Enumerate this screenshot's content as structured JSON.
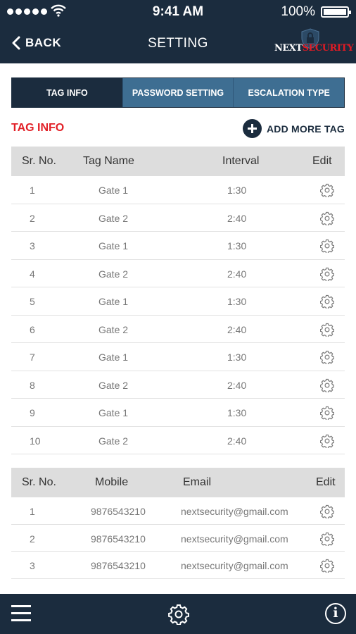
{
  "status_bar": {
    "time": "9:41 AM",
    "battery": "100%",
    "signal_icon": "signal-dots-icon",
    "wifi_icon": "wifi-icon",
    "battery_icon": "battery-icon"
  },
  "nav": {
    "back_label": "BACK",
    "title": "SETTING",
    "brand_part_a": "NEXT",
    "brand_part_b": "SECURITY"
  },
  "tabs": [
    {
      "label": "TAG INFO",
      "active": true
    },
    {
      "label": "PASSWORD SETTING",
      "active": false
    },
    {
      "label": "ESCALATION TYPE",
      "active": false
    }
  ],
  "tag_section": {
    "title": "TAG INFO",
    "add_label": "ADD MORE TAG",
    "columns": [
      "Sr. No.",
      "Tag Name",
      "Interval",
      "Edit"
    ],
    "rows": [
      {
        "sr": "1",
        "name": "Gate 1",
        "interval": "1:30"
      },
      {
        "sr": "2",
        "name": "Gate 2",
        "interval": "2:40"
      },
      {
        "sr": "3",
        "name": "Gate 1",
        "interval": "1:30"
      },
      {
        "sr": "4",
        "name": "Gate 2",
        "interval": "2:40"
      },
      {
        "sr": "5",
        "name": "Gate 1",
        "interval": "1:30"
      },
      {
        "sr": "6",
        "name": "Gate 2",
        "interval": "2:40"
      },
      {
        "sr": "7",
        "name": "Gate 1",
        "interval": "1:30"
      },
      {
        "sr": "8",
        "name": "Gate 2",
        "interval": "2:40"
      },
      {
        "sr": "9",
        "name": "Gate 1",
        "interval": "1:30"
      },
      {
        "sr": "10",
        "name": "Gate 2",
        "interval": "2:40"
      }
    ]
  },
  "escalation_section": {
    "columns": [
      "Sr. No.",
      "Mobile",
      "Email",
      "Edit"
    ],
    "rows": [
      {
        "sr": "1",
        "mobile": "9876543210",
        "email": "nextsecurity@gmail.com"
      },
      {
        "sr": "2",
        "mobile": "9876543210",
        "email": "nextsecurity@gmail.com"
      },
      {
        "sr": "3",
        "mobile": "9876543210",
        "email": "nextsecurity@gmail.com"
      }
    ]
  },
  "bottom_bar": {
    "menu_icon": "hamburger-menu-icon",
    "settings_icon": "gear-icon",
    "info_icon": "info-icon",
    "info_glyph": "i"
  },
  "colors": {
    "navy": "#1b2c3e",
    "tab_blue": "#3e6e92",
    "accent_red": "#e21f26",
    "header_gray": "#dddddd"
  }
}
